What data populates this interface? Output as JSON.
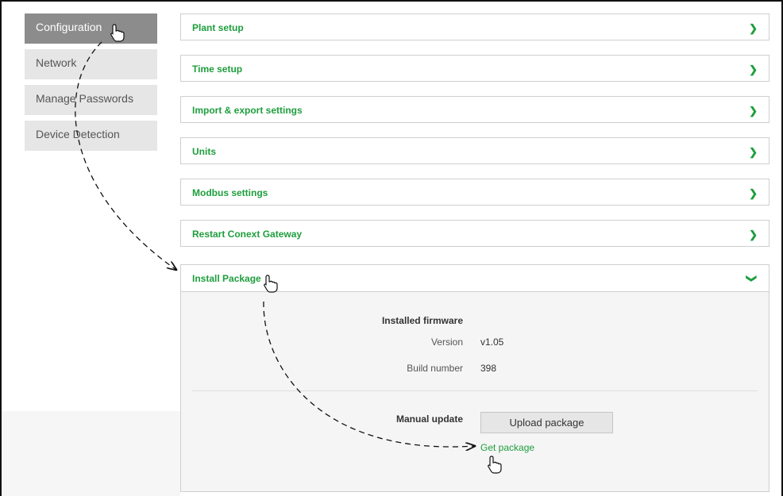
{
  "sidebar": {
    "items": [
      {
        "label": "Configuration",
        "active": true
      },
      {
        "label": "Network"
      },
      {
        "label": "Manage Passwords"
      },
      {
        "label": "Device Detection"
      }
    ]
  },
  "panels": [
    {
      "title": "Plant setup"
    },
    {
      "title": "Time setup"
    },
    {
      "title": "Import & export settings"
    },
    {
      "title": "Units"
    },
    {
      "title": "Modbus settings"
    },
    {
      "title": "Restart Conext Gateway"
    }
  ],
  "install": {
    "title": "Install Package",
    "firmware_heading": "Installed firmware",
    "version_label": "Version",
    "version_value": "v1.05",
    "build_label": "Build number",
    "build_value": "398",
    "manual_update_label": "Manual update",
    "upload_button": "Upload package",
    "get_package_link": "Get package"
  },
  "colors": {
    "accent": "#1e9e3d",
    "nav_active": "#8c8c8c",
    "nav_inactive": "#e6e6e6"
  },
  "icons": {
    "chevron": "chevron-right-icon",
    "cursor": "hand-pointer-icon"
  }
}
